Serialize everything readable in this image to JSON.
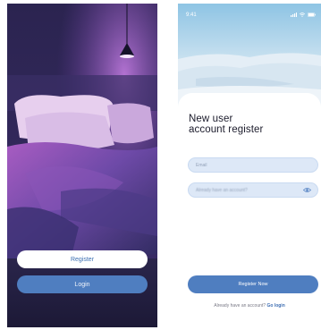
{
  "welcome_screen": {
    "register_label": "Register",
    "login_label": "Login"
  },
  "register_screen": {
    "status_time": "9:41",
    "title_line1": "New user",
    "title_line2": "account register",
    "email_placeholder": "Email",
    "password_placeholder": "Already have an account?",
    "register_button_label": "Register Now",
    "footer_text": "Already have an account?",
    "footer_link": "Go login"
  },
  "icons": {
    "status": [
      "signal-icon",
      "wifi-icon",
      "battery-icon"
    ],
    "password_toggle": "eye-icon"
  },
  "colors": {
    "primary": "#4f7ec0",
    "input_bg": "#dde8f7",
    "title_text": "#1b1b2b"
  }
}
